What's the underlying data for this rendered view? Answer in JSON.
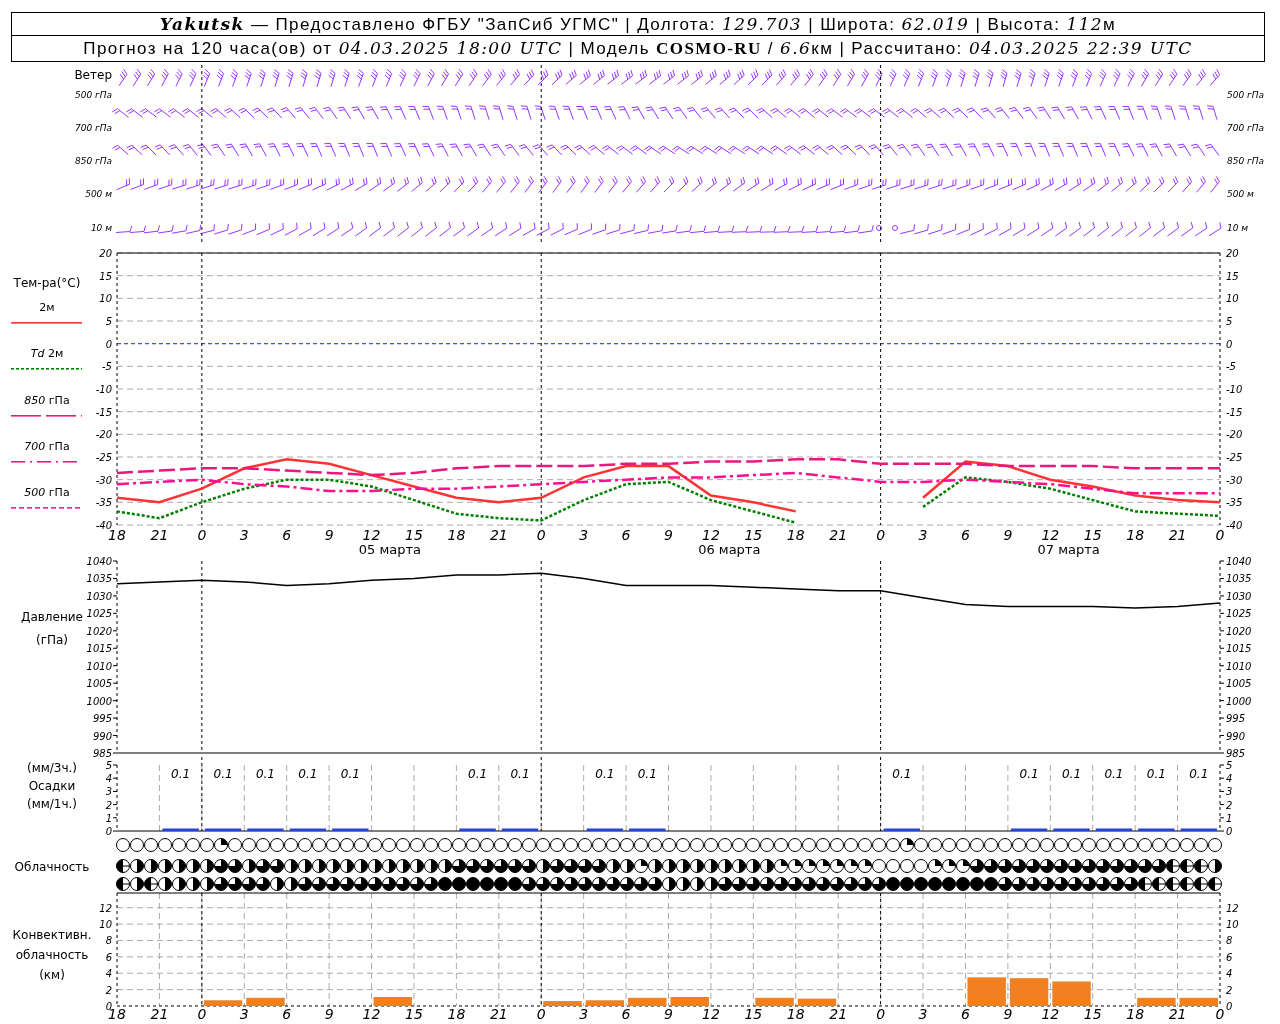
{
  "header": {
    "lines": [
      [
        {
          "text": "Yakutsk",
          "kind": "title"
        },
        {
          "text": " — Предоставлено ФГБУ \"ЗапСиб УГМС\" | Долгота: ",
          "kind": "plain"
        },
        {
          "text": "129.703",
          "kind": "italic"
        },
        {
          "text": " | Широта: ",
          "kind": "plain"
        },
        {
          "text": "62.019",
          "kind": "italic"
        },
        {
          "text": " | Высота: ",
          "kind": "plain"
        },
        {
          "text": "112",
          "kind": "italic"
        },
        {
          "text": "м",
          "kind": "plain"
        }
      ],
      [
        {
          "text": "Прогноз на 120 часа(ов) от ",
          "kind": "plain"
        },
        {
          "text": "04.03.2025 18:00 UTC",
          "kind": "italic"
        },
        {
          "text": " | Модель ",
          "kind": "plain"
        },
        {
          "text": "COSMO-RU",
          "kind": "bold"
        },
        {
          "text": " / ",
          "kind": "plain"
        },
        {
          "text": "6.6",
          "kind": "italic"
        },
        {
          "text": "км | Рассчитано: ",
          "kind": "plain"
        },
        {
          "text": "04.03.2025 22:39 UTC",
          "kind": "italic"
        }
      ]
    ]
  },
  "wind": {
    "title": "Ветер",
    "levels_left": [
      "500 гПа",
      "700 гПа",
      "850 гПа",
      "500 м",
      "10 м"
    ],
    "levels_right": [
      "500 гПа",
      "700 гПа",
      "850 гПа",
      "500 м",
      "10 м"
    ]
  },
  "temperature": {
    "title": "Тем-ра(°C)",
    "legend": [
      {
        "label": "2м",
        "kind": "solid",
        "color": "#ff3333"
      },
      {
        "label": "*Td* 2м",
        "kind": "dotted",
        "color": "#008000"
      },
      {
        "label": "*850* гПа",
        "kind": "longdash",
        "color": "#e8197d"
      },
      {
        "label": "*700* гПа",
        "kind": "dashdot",
        "color": "#ff0f8f"
      },
      {
        "label": "*500* гПа",
        "kind": "dashed",
        "color": "#ff1493"
      }
    ],
    "chart_data": {
      "type": "line",
      "categories": [
        "18",
        "21",
        "0",
        "3",
        "6",
        "9",
        "12",
        "15",
        "18",
        "21",
        "0",
        "3",
        "6",
        "9",
        "12",
        "15",
        "18",
        "21",
        "0",
        "3",
        "6",
        "9",
        "12",
        "15",
        "18",
        "21",
        "0"
      ],
      "series": [
        {
          "color": "#ff3333",
          "line_style": "solid",
          "values": [
            -34,
            -35,
            -32,
            -27.5,
            -25.5,
            -26.5,
            -29,
            -31.5,
            -34,
            -35,
            -34,
            -29.5,
            -27,
            -27,
            -33.5,
            -35,
            -37,
            null,
            null,
            -34,
            -26,
            -27,
            -30,
            -31.5,
            -33.5,
            -34.5,
            -35
          ]
        },
        {
          "color": "#008000",
          "line_style": "dotted",
          "values": [
            -37,
            -38.5,
            -35,
            -32,
            -30,
            -30,
            -31.5,
            -34.5,
            -37.5,
            -38.5,
            -39,
            -34.5,
            -31,
            -30.5,
            -34.5,
            -37,
            -39.5,
            null,
            null,
            -36,
            -29.5,
            -30.5,
            -32,
            -34.5,
            -37,
            -37.5,
            -38
          ]
        },
        {
          "color": "#e8197d",
          "line_style": "longdash",
          "values": [
            -28.5,
            -28,
            -27.5,
            -27.5,
            -28,
            -28.5,
            -29,
            -28.5,
            -27.5,
            -27,
            -27,
            -27,
            -26.5,
            -26.5,
            -26,
            -26,
            -25.5,
            -25.5,
            -26.5,
            -26.5,
            -26.5,
            -27,
            -27,
            -27,
            -27.5,
            -27.5,
            -27.5
          ]
        },
        {
          "color": "#ff0f8f",
          "line_style": "dashdot",
          "values": [
            -31,
            -30.5,
            -30,
            -31,
            -31.5,
            -32.5,
            -32.5,
            -32,
            -32,
            -31.5,
            -31,
            -30.5,
            -30,
            -29.5,
            -29.5,
            -29,
            -28.5,
            -29.5,
            -30.5,
            -30.5,
            -30,
            -30.5,
            -31,
            -32,
            -33,
            -33,
            -33
          ]
        }
      ],
      "ylim": [
        -40,
        20
      ],
      "yticks": [
        -40,
        -35,
        -30,
        -25,
        -20,
        -15,
        -10,
        -5,
        0,
        5,
        10,
        15,
        20
      ],
      "grid": true,
      "ref_lines": [
        {
          "axis": "y",
          "value": 0,
          "color": "#3355ff"
        }
      ]
    },
    "right_ticks": [
      "20",
      "15",
      "10",
      "5",
      "0",
      "-5",
      "-10",
      "-15",
      "-20",
      "-25",
      "-30",
      "-35",
      "-40"
    ],
    "days": [
      "05 марта",
      "06 марта",
      "07 марта"
    ]
  },
  "pressure": {
    "labels": [
      "Давление",
      "(гПа)"
    ],
    "chart_data": {
      "type": "line",
      "categories": [
        null,
        null,
        null,
        null,
        null,
        null,
        null,
        null,
        null,
        null,
        null,
        null,
        null,
        null,
        null,
        null,
        null,
        null,
        null,
        null,
        null,
        null,
        null,
        null,
        null,
        null,
        null
      ],
      "series": [
        {
          "color": "#000000",
          "values": [
            1033.5,
            1034,
            1034.5,
            1034,
            1033,
            1033.5,
            1034.5,
            1035,
            1036,
            1036,
            1036.5,
            1035,
            1033,
            1033,
            1033,
            1032.5,
            1032,
            1031.5,
            1031.5,
            1029.5,
            1027.5,
            1027,
            1027,
            1027,
            1026.5,
            1027,
            1028
          ]
        }
      ],
      "ylim": [
        985,
        1040
      ],
      "yticks": [
        985,
        990,
        995,
        1000,
        1005,
        1010,
        1015,
        1020,
        1025,
        1030,
        1035,
        1040
      ],
      "grid": true
    },
    "right_ticks": [
      "1040",
      "1035",
      "1030",
      "1025",
      "1020",
      "1015",
      "1010",
      "1005",
      "1000",
      "995",
      "990",
      "985"
    ]
  },
  "precipitation": {
    "labels": [
      "(мм/3ч.)",
      "Осадки",
      "(мм/1ч.)"
    ],
    "chart_data": {
      "type": "bar",
      "categories": [
        null,
        null,
        null,
        null,
        null,
        null,
        null,
        null,
        null,
        null,
        null,
        null,
        null,
        null,
        null,
        null,
        null,
        null,
        null,
        null,
        null,
        null,
        null,
        null,
        null,
        null
      ],
      "series": [
        {
          "color": "#2244dd",
          "values": [
            0,
            0.1,
            0.1,
            0.1,
            0.1,
            0.1,
            0,
            0,
            0.1,
            0.1,
            0,
            0.1,
            0.1,
            0,
            0,
            0,
            0,
            0,
            0.1,
            0,
            0,
            0.1,
            0.1,
            0.1,
            0.1,
            0.1
          ]
        }
      ],
      "ylim": [
        0,
        5
      ],
      "yticks": [
        0,
        1,
        2,
        3,
        4,
        5
      ],
      "value_labels": [
        null,
        "0.1",
        "0.1",
        "0.1",
        "0.1",
        "0.1",
        null,
        null,
        "0.1",
        "0.1",
        null,
        "0.1",
        "0.1",
        null,
        null,
        null,
        null,
        null,
        "0.1",
        null,
        null,
        "0.1",
        "0.1",
        "0.1",
        "0.1",
        "0.1"
      ]
    },
    "right_ticks": [
      "5",
      "4",
      "3",
      "2",
      "1",
      "0"
    ]
  },
  "cloudiness": {
    "label": "Облачность",
    "rows": [
      [
        {
          "kind": "clear"
        },
        {
          "kind": "clear"
        },
        {
          "kind": "clear"
        },
        {
          "kind": "clear"
        },
        {
          "kind": "clear"
        },
        {
          "kind": "clear"
        },
        {
          "kind": "clear"
        },
        {
          "kind": "few"
        },
        {
          "kind": "clear"
        },
        {
          "kind": "clear"
        },
        {
          "kind": "clear"
        },
        {
          "kind": "clear"
        },
        {
          "kind": "clear"
        },
        {
          "kind": "clear"
        },
        {
          "kind": "clear"
        },
        {
          "kind": "clear"
        },
        {
          "kind": "clear"
        },
        {
          "kind": "clear"
        },
        {
          "kind": "clear"
        },
        {
          "kind": "clear"
        },
        {
          "kind": "clear"
        },
        {
          "kind": "clear"
        },
        {
          "kind": "clear"
        },
        {
          "kind": "clear"
        },
        {
          "kind": "clear"
        },
        {
          "kind": "clear"
        },
        {
          "kind": "clear"
        },
        {
          "kind": "clear"
        },
        {
          "kind": "clear"
        },
        {
          "kind": "clear"
        },
        {
          "kind": "clear"
        },
        {
          "kind": "clear"
        },
        {
          "kind": "clear"
        },
        {
          "kind": "clear"
        },
        {
          "kind": "clear"
        },
        {
          "kind": "clear"
        },
        {
          "kind": "clear"
        },
        {
          "kind": "clear"
        },
        {
          "kind": "clear"
        },
        {
          "kind": "clear"
        },
        {
          "kind": "clear"
        },
        {
          "kind": "clear"
        },
        {
          "kind": "clear"
        },
        {
          "kind": "clear"
        },
        {
          "kind": "clear"
        },
        {
          "kind": "clear"
        },
        {
          "kind": "clear"
        },
        {
          "kind": "clear"
        },
        {
          "kind": "clear"
        },
        {
          "kind": "clear"
        },
        {
          "kind": "clear"
        },
        {
          "kind": "clear"
        },
        {
          "kind": "clear"
        },
        {
          "kind": "clear"
        },
        {
          "kind": "clear"
        },
        {
          "kind": "clear"
        },
        {
          "kind": "few"
        },
        {
          "kind": "clear"
        },
        {
          "kind": "clear"
        },
        {
          "kind": "clear"
        },
        {
          "kind": "clear"
        },
        {
          "kind": "clear"
        },
        {
          "kind": "clear"
        },
        {
          "kind": "clear"
        },
        {
          "kind": "clear"
        },
        {
          "kind": "clear"
        },
        {
          "kind": "clear"
        },
        {
          "kind": "clear"
        },
        {
          "kind": "clear"
        },
        {
          "kind": "clear"
        },
        {
          "kind": "clear"
        },
        {
          "kind": "clear"
        },
        {
          "kind": "clear"
        },
        {
          "kind": "clear"
        },
        {
          "kind": "clear"
        },
        {
          "kind": "clear"
        },
        {
          "kind": "clear"
        },
        {
          "kind": "clear"
        },
        {
          "kind": "clear"
        }
      ],
      [
        {
          "kind": "split"
        },
        {
          "kind": "half"
        },
        {
          "kind": "half"
        },
        {
          "kind": "half"
        },
        {
          "kind": "half"
        },
        {
          "kind": "half"
        },
        {
          "kind": "half"
        },
        {
          "kind": "most"
        },
        {
          "kind": "most"
        },
        {
          "kind": "half"
        },
        {
          "kind": "most"
        },
        {
          "kind": "most"
        },
        {
          "kind": "half"
        },
        {
          "kind": "half"
        },
        {
          "kind": "half"
        },
        {
          "kind": "half"
        },
        {
          "kind": "half"
        },
        {
          "kind": "half"
        },
        {
          "kind": "half"
        },
        {
          "kind": "half"
        },
        {
          "kind": "half"
        },
        {
          "kind": "half"
        },
        {
          "kind": "half"
        },
        {
          "kind": "half"
        },
        {
          "kind": "most"
        },
        {
          "kind": "most"
        },
        {
          "kind": "most"
        },
        {
          "kind": "most"
        },
        {
          "kind": "most"
        },
        {
          "kind": "most"
        },
        {
          "kind": "half"
        },
        {
          "kind": "most"
        },
        {
          "kind": "most"
        },
        {
          "kind": "most"
        },
        {
          "kind": "most"
        },
        {
          "kind": "half"
        },
        {
          "kind": "half"
        },
        {
          "kind": "few"
        },
        {
          "kind": "half"
        },
        {
          "kind": "half"
        },
        {
          "kind": "half"
        },
        {
          "kind": "half"
        },
        {
          "kind": "half"
        },
        {
          "kind": "half"
        },
        {
          "kind": "half"
        },
        {
          "kind": "half"
        },
        {
          "kind": "half"
        },
        {
          "kind": "few"
        },
        {
          "kind": "few"
        },
        {
          "kind": "few"
        },
        {
          "kind": "few"
        },
        {
          "kind": "few"
        },
        {
          "kind": "few"
        },
        {
          "kind": "few"
        },
        {
          "kind": "clear"
        },
        {
          "kind": "clear"
        },
        {
          "kind": "clear"
        },
        {
          "kind": "clear"
        },
        {
          "kind": "few"
        },
        {
          "kind": "few"
        },
        {
          "kind": "few"
        },
        {
          "kind": "most"
        },
        {
          "kind": "most"
        },
        {
          "kind": "most"
        },
        {
          "kind": "most"
        },
        {
          "kind": "most"
        },
        {
          "kind": "most"
        },
        {
          "kind": "most"
        },
        {
          "kind": "most"
        },
        {
          "kind": "most"
        },
        {
          "kind": "most"
        },
        {
          "kind": "most"
        },
        {
          "kind": "most"
        },
        {
          "kind": "most"
        },
        {
          "kind": "most"
        },
        {
          "kind": "split"
        },
        {
          "kind": "split"
        },
        {
          "kind": "split"
        },
        {
          "kind": "half"
        }
      ],
      [
        {
          "kind": "split"
        },
        {
          "kind": "half"
        },
        {
          "kind": "split"
        },
        {
          "kind": "half"
        },
        {
          "kind": "half"
        },
        {
          "kind": "half"
        },
        {
          "kind": "half"
        },
        {
          "kind": "most"
        },
        {
          "kind": "most"
        },
        {
          "kind": "most"
        },
        {
          "kind": "most"
        },
        {
          "kind": "half"
        },
        {
          "kind": "half"
        },
        {
          "kind": "most"
        },
        {
          "kind": "most"
        },
        {
          "kind": "most"
        },
        {
          "kind": "most"
        },
        {
          "kind": "most"
        },
        {
          "kind": "most"
        },
        {
          "kind": "most"
        },
        {
          "kind": "most"
        },
        {
          "kind": "most"
        },
        {
          "kind": "most"
        },
        {
          "kind": "full"
        },
        {
          "kind": "full"
        },
        {
          "kind": "full"
        },
        {
          "kind": "full"
        },
        {
          "kind": "full"
        },
        {
          "kind": "full"
        },
        {
          "kind": "most"
        },
        {
          "kind": "most"
        },
        {
          "kind": "most"
        },
        {
          "kind": "most"
        },
        {
          "kind": "most"
        },
        {
          "kind": "most"
        },
        {
          "kind": "most"
        },
        {
          "kind": "most"
        },
        {
          "kind": "most"
        },
        {
          "kind": "most"
        },
        {
          "kind": "half"
        },
        {
          "kind": "half"
        },
        {
          "kind": "half"
        },
        {
          "kind": "half"
        },
        {
          "kind": "most"
        },
        {
          "kind": "most"
        },
        {
          "kind": "most"
        },
        {
          "kind": "most"
        },
        {
          "kind": "most"
        },
        {
          "kind": "most"
        },
        {
          "kind": "most"
        },
        {
          "kind": "most"
        },
        {
          "kind": "most"
        },
        {
          "kind": "most"
        },
        {
          "kind": "most"
        },
        {
          "kind": "most"
        },
        {
          "kind": "full"
        },
        {
          "kind": "full"
        },
        {
          "kind": "full"
        },
        {
          "kind": "full"
        },
        {
          "kind": "full"
        },
        {
          "kind": "full"
        },
        {
          "kind": "full"
        },
        {
          "kind": "full"
        },
        {
          "kind": "most"
        },
        {
          "kind": "most"
        },
        {
          "kind": "most"
        },
        {
          "kind": "most"
        },
        {
          "kind": "most"
        },
        {
          "kind": "most"
        },
        {
          "kind": "most"
        },
        {
          "kind": "most"
        },
        {
          "kind": "most"
        },
        {
          "kind": "most"
        },
        {
          "kind": "split"
        },
        {
          "kind": "split"
        },
        {
          "kind": "split"
        },
        {
          "kind": "split"
        },
        {
          "kind": "split"
        },
        {
          "kind": "split"
        }
      ]
    ]
  },
  "convective": {
    "labels": [
      "Конвективн.",
      "облачность",
      "(км)"
    ],
    "chart_data": {
      "type": "bar",
      "categories": [
        "18",
        null,
        "21",
        null,
        "0",
        null,
        "3",
        null,
        "6",
        null,
        "9",
        null,
        "12",
        null,
        "15",
        null,
        "18",
        null,
        "21",
        null,
        "0",
        null,
        "3",
        null,
        "6",
        null,
        "9",
        null,
        "12",
        null,
        "15",
        null,
        "18",
        null,
        "21",
        null,
        "0",
        null,
        "3",
        null,
        "6",
        null,
        "9",
        null,
        "12",
        null,
        "15",
        null,
        "18",
        null,
        "21",
        null,
        "0"
      ],
      "series": [
        {
          "color": "#f08020",
          "values": [
            null,
            null,
            null,
            null,
            null,
            0.7,
            null,
            1.0,
            null,
            null,
            null,
            null,
            null,
            1.1,
            null,
            null,
            null,
            null,
            null,
            null,
            null,
            0.6,
            null,
            0.7,
            null,
            1.0,
            null,
            1.1,
            null,
            null,
            null,
            1.0,
            null,
            0.9,
            null,
            null,
            null,
            null,
            null,
            null,
            null,
            3.5,
            null,
            3.4,
            null,
            3.0,
            null,
            null,
            null,
            1.0,
            null,
            1.0,
            null
          ]
        }
      ],
      "ylim": [
        0,
        13.8
      ],
      "yticks": [
        0,
        2,
        4,
        6,
        8,
        10,
        12
      ],
      "grid": true
    },
    "right_ticks": [
      "12",
      "10",
      "8",
      "6",
      "4",
      "2",
      "0"
    ]
  }
}
